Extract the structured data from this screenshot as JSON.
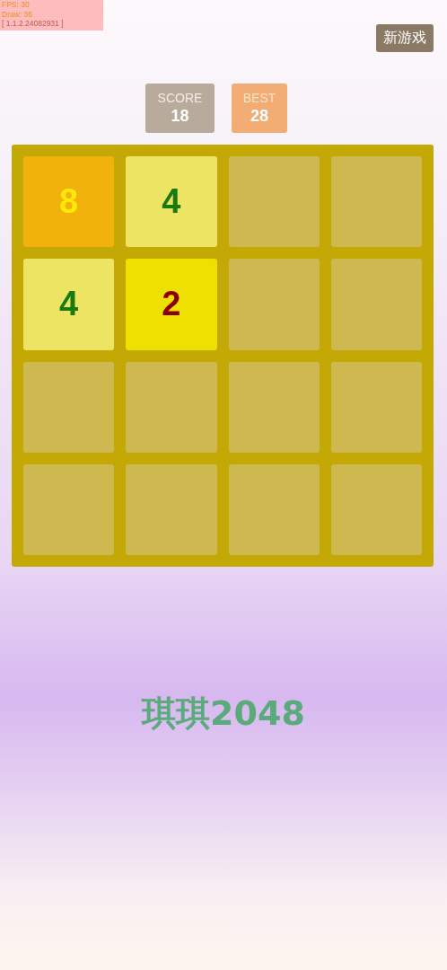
{
  "debug": {
    "fps": "FPS: 30",
    "draw": "Draw: 36",
    "version": "[ 1.1.2.24082931 ]"
  },
  "new_game_button": "新游戏",
  "scores": [
    {
      "kind": "score",
      "label": "SCORE",
      "value": "18"
    },
    {
      "kind": "best",
      "label": "BEST",
      "value": "28"
    }
  ],
  "board": {
    "tiles": [
      {
        "kind": "number",
        "value": "8"
      },
      {
        "kind": "number",
        "value": "4"
      },
      {
        "kind": "empty"
      },
      {
        "kind": "empty"
      },
      {
        "kind": "number",
        "value": "4"
      },
      {
        "kind": "number",
        "value": "2"
      },
      {
        "kind": "empty"
      },
      {
        "kind": "empty"
      },
      {
        "kind": "empty"
      },
      {
        "kind": "empty"
      },
      {
        "kind": "empty"
      },
      {
        "kind": "empty"
      },
      {
        "kind": "empty"
      },
      {
        "kind": "empty"
      },
      {
        "kind": "empty"
      },
      {
        "kind": "empty"
      }
    ]
  },
  "title": "琪琪2048"
}
